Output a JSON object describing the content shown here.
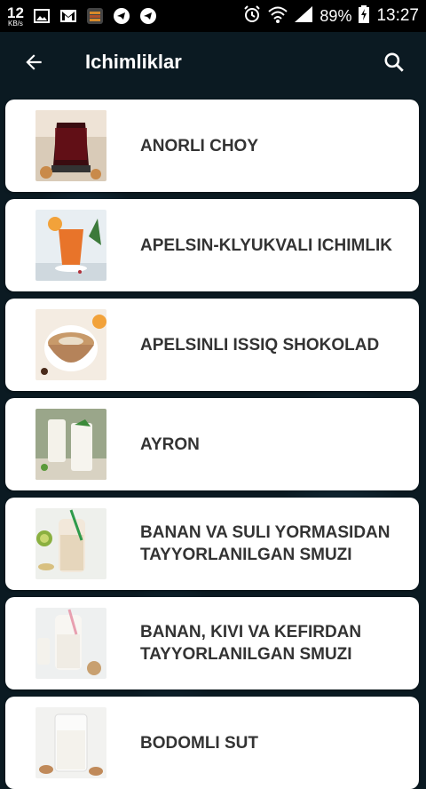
{
  "status_bar": {
    "speed_value": "12",
    "speed_unit": "KB/s",
    "battery": "89%",
    "time": "13:27"
  },
  "app_bar": {
    "title": "Ichimliklar"
  },
  "items": [
    {
      "title": "ANORLI CHOY"
    },
    {
      "title": "APELSIN-KLYUKVALI ICHIMLIK"
    },
    {
      "title": "APELSINLI ISSIQ SHOKOLAD"
    },
    {
      "title": "AYRON"
    },
    {
      "title": "BANAN VA SULI YORMASIDAN\nTAYYORLANILGAN SMUZI"
    },
    {
      "title": "BANAN, KIVI VA KEFIRDAN\nTAYYORLANILGAN SMUZI"
    },
    {
      "title": "BODOMLI SUT"
    }
  ]
}
